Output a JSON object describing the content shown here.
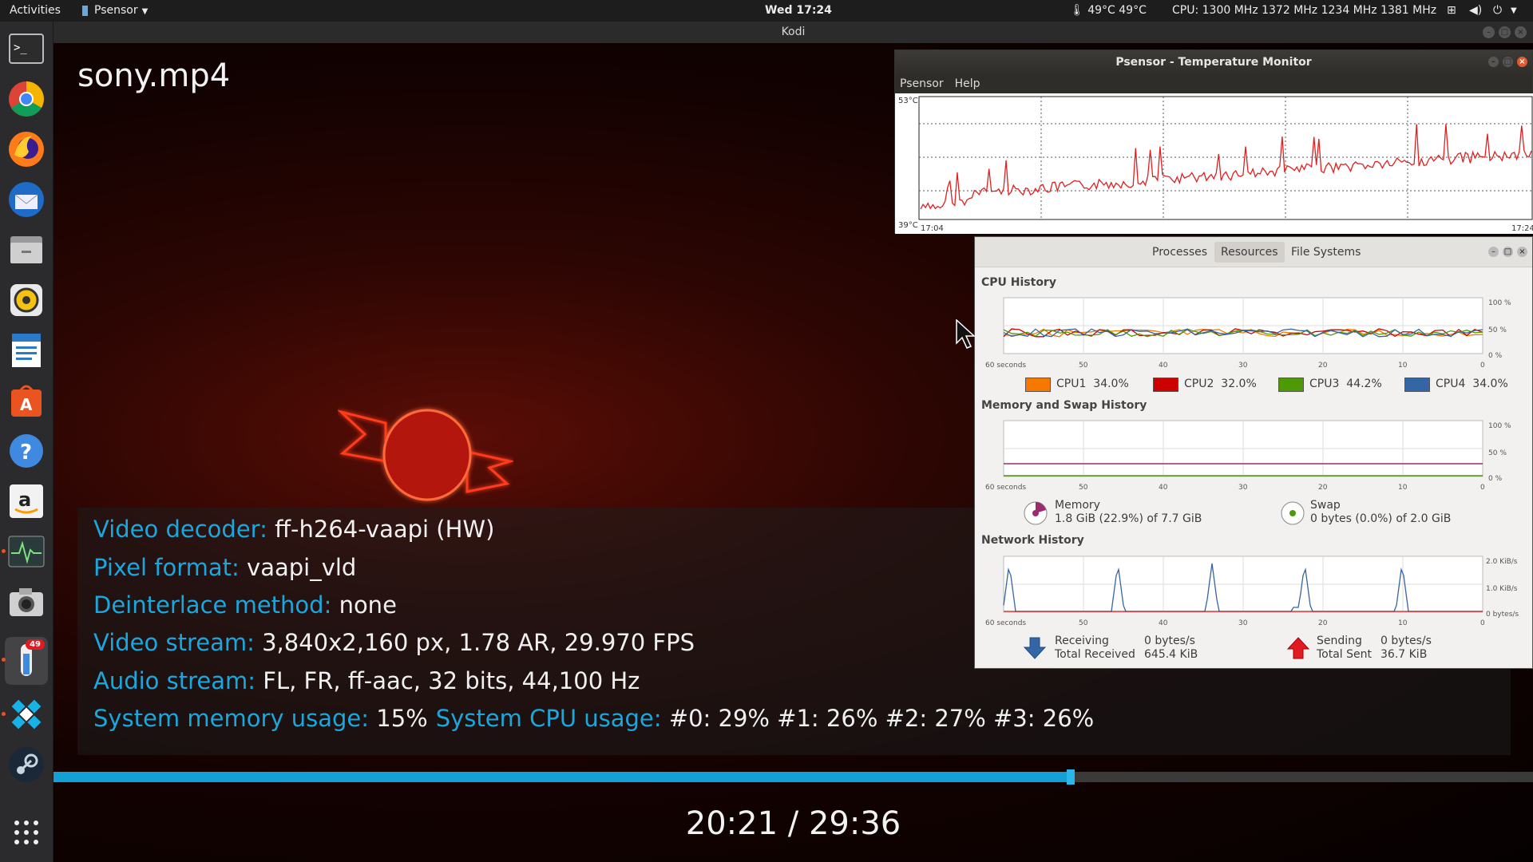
{
  "topbar": {
    "activities": "Activities",
    "app_menu": "Psensor",
    "clock": "Wed 17:24",
    "temps": "49°C 49°C",
    "cpu_freq": "CPU: 1300 MHz 1372 MHz 1234 MHz 1381 MHz"
  },
  "dock": {
    "items": [
      {
        "name": "terminal-icon"
      },
      {
        "name": "chrome-icon"
      },
      {
        "name": "firefox-icon"
      },
      {
        "name": "thunderbird-icon"
      },
      {
        "name": "files-icon"
      },
      {
        "name": "rhythmbox-icon"
      },
      {
        "name": "writer-icon"
      },
      {
        "name": "software-center-icon"
      },
      {
        "name": "help-icon"
      },
      {
        "name": "amazon-icon"
      },
      {
        "name": "system-monitor-icon"
      },
      {
        "name": "screenshot-icon"
      },
      {
        "name": "psensor-icon"
      },
      {
        "name": "kodi-icon"
      },
      {
        "name": "steam-icon"
      },
      {
        "name": "show-apps-icon"
      }
    ],
    "badge": "49"
  },
  "kodi": {
    "window_title": "Kodi",
    "video_title": "sony.mp4",
    "osd": [
      {
        "key": "Video decoder:",
        "value": "ff-h264-vaapi (HW)"
      },
      {
        "key": "Pixel format:",
        "value": "vaapi_vld"
      },
      {
        "key": "Deinterlace method:",
        "value": "none"
      },
      {
        "key": "Video stream:",
        "value": "3,840x2,160 px, 1.78 AR, 29.970 FPS"
      },
      {
        "key": "Audio stream:",
        "value": "FL, FR, ff-aac, 32 bits, 44,100 Hz"
      }
    ],
    "mem_key": "System memory usage:",
    "mem_val": "15%",
    "cpu_key": "System CPU usage:",
    "cpu_val": "#0:  29% #1:  26% #2:  27% #3:  26%",
    "time": "20:21 / 29:36",
    "progress_fraction": 0.6875
  },
  "psensor": {
    "title": "Psensor - Temperature Monitor",
    "menu": [
      "Psensor",
      "Help"
    ],
    "y_max": "53°C",
    "y_min": "39°C",
    "x_start": "17:04",
    "x_end": "17:24",
    "line_color": "#e02020"
  },
  "sysmon": {
    "tabs": [
      "Processes",
      "Resources",
      "File Systems"
    ],
    "cpu_title": "CPU History",
    "mem_title": "Memory and Swap History",
    "net_title": "Network History",
    "x_ticks": [
      "60 seconds",
      "50",
      "40",
      "30",
      "20",
      "10",
      "0"
    ],
    "pct_ticks": [
      "100 %",
      "50 %",
      "0 %"
    ],
    "net_ticks": [
      "2.0 KiB/s",
      "1.0 KiB/s",
      "0 bytes/s"
    ],
    "cpus": [
      {
        "label": "CPU1",
        "value": "34.0%",
        "color": "#f57900"
      },
      {
        "label": "CPU2",
        "value": "32.0%",
        "color": "#cc0000"
      },
      {
        "label": "CPU3",
        "value": "44.2%",
        "color": "#4e9a06"
      },
      {
        "label": "CPU4",
        "value": "34.0%",
        "color": "#3465a4"
      }
    ],
    "memory_label": "Memory",
    "memory_value": "1.8 GiB (22.9%) of 7.7 GiB",
    "swap_label": "Swap",
    "swap_value": "0 bytes (0.0%) of 2.0 GiB",
    "receiving_label": "Receiving",
    "total_received_label": "Total Received",
    "receiving_value": "0 bytes/s",
    "total_received_value": "645.4 KiB",
    "sending_label": "Sending",
    "total_sent_label": "Total Sent",
    "sending_value": "0 bytes/s",
    "total_sent_value": "36.7 KiB"
  }
}
